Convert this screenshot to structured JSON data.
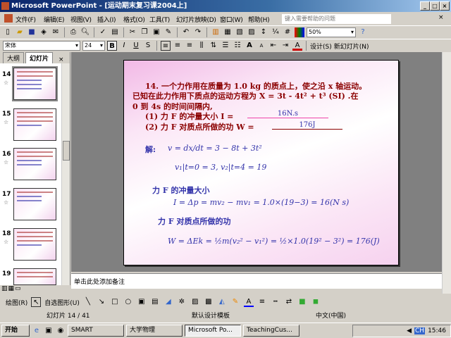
{
  "window": {
    "title": "Microsoft PowerPoint - [运动期末复习课2004上]",
    "min": "_",
    "max": "□",
    "close": "×"
  },
  "menu": {
    "items": [
      "文件(F)",
      "编辑(E)",
      "视图(V)",
      "插入(I)",
      "格式(O)",
      "工具(T)",
      "幻灯片放映(D)",
      "窗口(W)",
      "帮助(H)"
    ],
    "ask_placeholder": "键入需要帮助的问题",
    "close": "×"
  },
  "toolbar1": {
    "zoom": "50%"
  },
  "toolbar2": {
    "font": "宋体",
    "size": "24",
    "bold": "B",
    "italic": "I",
    "underline": "U",
    "shadow": "S",
    "grow": "A",
    "shrink": "A",
    "font_color": "A",
    "design": "设计(S)",
    "new_slide": "新幻灯片(N)"
  },
  "left_panel": {
    "tabs": [
      "大纲",
      "幻灯片"
    ],
    "close": "×",
    "slides": [
      {
        "num": "14"
      },
      {
        "num": "15"
      },
      {
        "num": "16"
      },
      {
        "num": "17"
      },
      {
        "num": "18"
      },
      {
        "num": "19"
      }
    ]
  },
  "slide": {
    "q1": "14. 一个力作用在质量为 1.0 kg 的质点上，使之沿 x 轴运动。",
    "q2": "已知在此力作用下质点的运动方程为 X = 3t - 4t² + t³ (SI) .在",
    "q3": "0 到 4s 的时间间隔内,",
    "p1": "(1) 力 F 的冲量大小 I =",
    "a1": "16N.s",
    "p2": "(2) 力 F 对质点所做的功 W =",
    "a2": "176J",
    "sol_label": "解:",
    "eq_v": "v = dx/dt = 3 − 8t + 3t²",
    "eq_v12": "v₁|t=0 = 3,     v₂|t=4 = 19",
    "h_impulse": "力 F 的冲量大小",
    "eq_I": "I = Δp = mv₂ − mv₁ = 1.0×(19−3) = 16(N s)",
    "h_work": "力 F 对质点所做的功",
    "eq_W": "W = ΔEk = ½m(v₂² − v₁²) = ½×1.0(19² − 3²) = 176(J)"
  },
  "notes": {
    "placeholder": "单击此处添加备注"
  },
  "drawbar": {
    "draw": "绘图(R)",
    "autoshapes": "自选图形(U)"
  },
  "status": {
    "slide": "幻灯片 14 / 41",
    "design": "默认设计模板",
    "lang": "中文(中国)"
  },
  "taskbar": {
    "start": "开始",
    "tasks": [
      "SMART",
      "大学物理",
      "Microsoft Po...",
      "TeachingCus..."
    ],
    "time": "15:46"
  }
}
